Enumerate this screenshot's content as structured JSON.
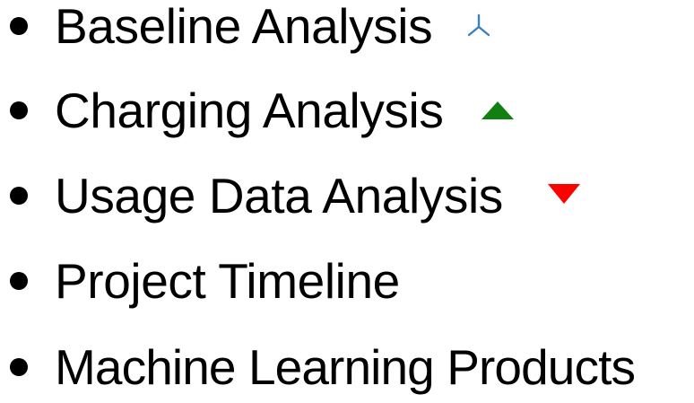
{
  "items": [
    {
      "label": "Baseline Analysis",
      "marker_icon": "tri-down-marker-icon",
      "marker_color": "#3a80c0"
    },
    {
      "label": "Charging Analysis",
      "marker_icon": "triangle-up-icon",
      "marker_color": "#118011"
    },
    {
      "label": "Usage Data Analysis",
      "marker_icon": "triangle-down-icon",
      "marker_color": "#ff0000"
    },
    {
      "label": "Project Timeline"
    },
    {
      "label": "Machine Learning Products"
    }
  ],
  "bullet_glyph": "•",
  "text_color": "#000000",
  "background_color": "#ffffff"
}
